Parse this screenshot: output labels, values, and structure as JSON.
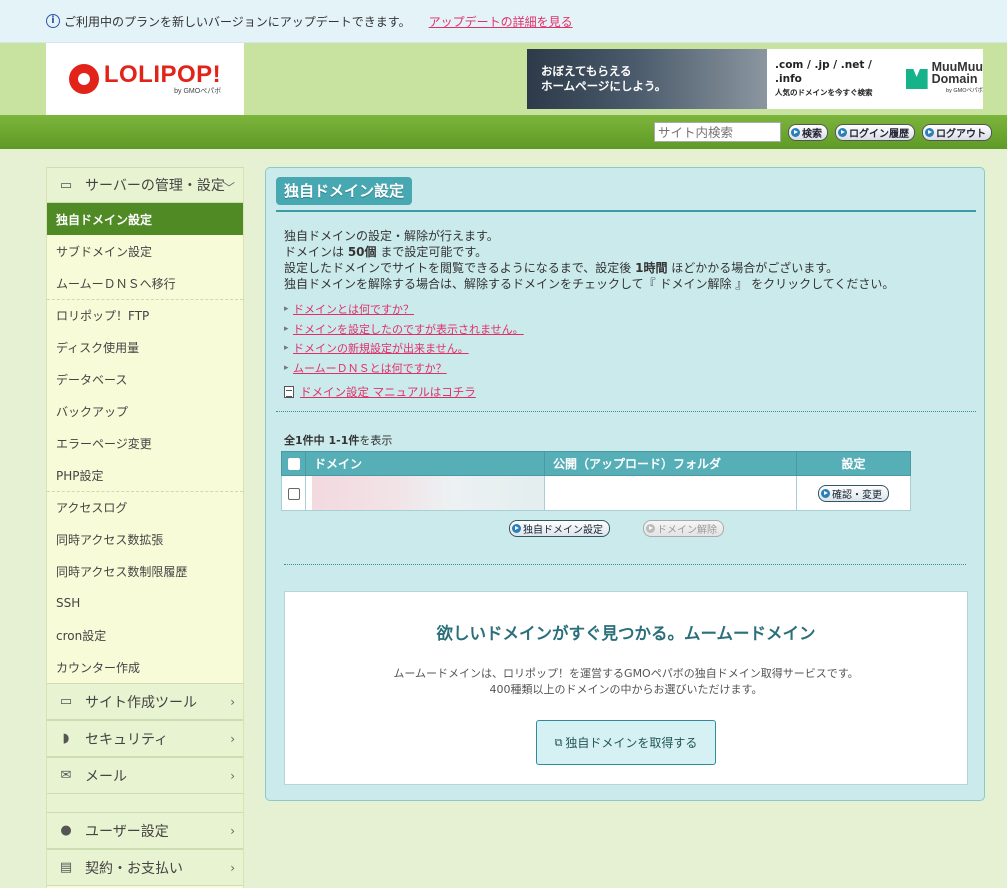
{
  "notice": {
    "info_symbol": "i",
    "text": "ご利用中のプランを新しいバージョンにアップデートできます。",
    "link": "アップデートの詳細を見る"
  },
  "header": {
    "logo_text": "LOLIPOP!",
    "logo_sub": "by GMOペパボ",
    "banner_text_line1": "おぼえてもらえる",
    "banner_text_line2": "ホームページにしよう。",
    "banner_tlds": ".com / .jp / .net / .info",
    "banner_tagline": "人気のドメインを今すぐ検索",
    "muumuu_line1": "MuuMuu",
    "muumuu_line2": "Domain",
    "muumuu_sub": "by GMOペパボ"
  },
  "navbar": {
    "search_placeholder": "サイト内検索",
    "search_button": "検索",
    "login_history": "ログイン履歴",
    "logout": "ログアウト"
  },
  "sidebar": {
    "server_section": "サーバーの管理・設定",
    "items": [
      "独自ドメイン設定",
      "サブドメイン設定",
      "ムームーＤＮＳへ移行",
      "ロリポップ！FTP",
      "ディスク使用量",
      "データベース",
      "バックアップ",
      "エラーページ変更",
      "PHP設定",
      "アクセスログ",
      "同時アクセス数拡張",
      "同時アクセス数制限履歴",
      "SSH",
      "cron設定",
      "カウンター作成"
    ],
    "site_tools": "サイト作成ツール",
    "security": "セキュリティ",
    "mail": "メール",
    "user_settings": "ユーザー設定",
    "billing": "契約・お支払い"
  },
  "main": {
    "title": "独自ドメイン設定",
    "desc_line1": "独自ドメインの設定・解除が行えます。",
    "desc_line2_a": "ドメインは ",
    "desc_line2_b": "50個",
    "desc_line2_c": " まで設定可能です。",
    "desc_line3_a": "設定したドメインでサイトを閲覧できるようになるまで、設定後 ",
    "desc_line3_b": "1時間",
    "desc_line3_c": " ほどかかる場合がございます。",
    "desc_line4": "独自ドメインを解除する場合は、解除するドメインをチェックして『 ドメイン解除 』 をクリックしてください。",
    "faq": [
      "ドメインとは何ですか？",
      "ドメインを設定したのですが表示されません。",
      "ドメインの新規設定が出来ません。",
      "ムームーＤＮＳとは何ですか？"
    ],
    "manual_link": "ドメイン設定 マニュアルはコチラ",
    "count_bold": "全1件中 1-1件",
    "count_rest": "を表示",
    "table": {
      "col_domain": "ドメイン",
      "col_folder": "公開（アップロード）フォルダ",
      "col_setting": "設定",
      "row_button": "確認・変更"
    },
    "btn_add": "独自ドメイン設定",
    "btn_remove": "ドメイン解除",
    "promo_title": "欲しいドメインがすぐ見つかる。ムームードメイン",
    "promo_line1": "ムームードメインは、ロリポップ！を運営するGMOペパボの独自ドメイン取得サービスです。",
    "promo_line2": "400種類以上のドメインの中からお選びいただけます。",
    "promo_button": "独自ドメインを取得する"
  }
}
